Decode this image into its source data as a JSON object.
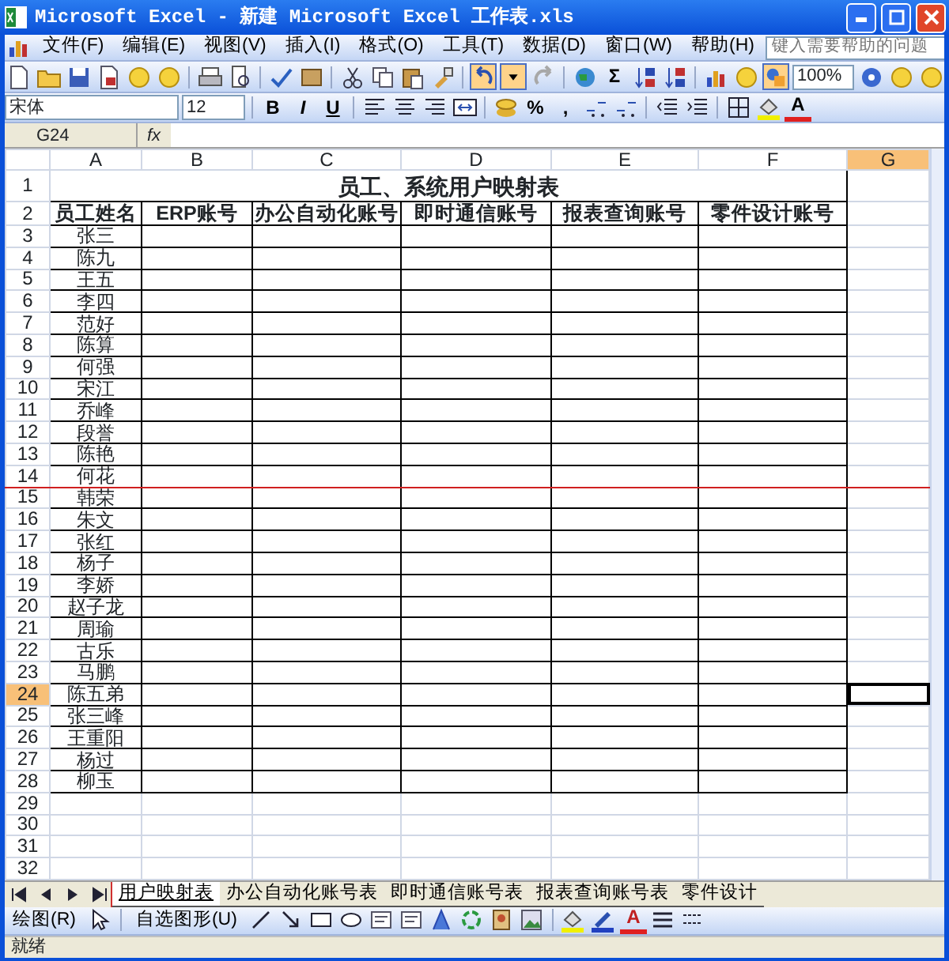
{
  "window": {
    "title": "Microsoft Excel - 新建 Microsoft Excel 工作表.xls"
  },
  "menu": {
    "items": [
      "文件(F)",
      "编辑(E)",
      "视图(V)",
      "插入(I)",
      "格式(O)",
      "工具(T)",
      "数据(D)",
      "窗口(W)",
      "帮助(H)"
    ],
    "help_box": {
      "placeholder": "键入需要帮助的问题"
    }
  },
  "standard_toolbar": {
    "sum": "Σ",
    "zoom": "100%"
  },
  "format_toolbar": {
    "font": "宋体",
    "size": "12",
    "bold": "B",
    "italic": "I",
    "underline": "U",
    "percent": "%",
    "comma": ",",
    "font_color": "A"
  },
  "formula_bar": {
    "name_box": "G24",
    "fx": "fx"
  },
  "sheet": {
    "columns": [
      {
        "label": "A",
        "selected": false
      },
      {
        "label": "B",
        "selected": false
      },
      {
        "label": "C",
        "selected": false
      },
      {
        "label": "D",
        "selected": false
      },
      {
        "label": "E",
        "selected": false
      },
      {
        "label": "F",
        "selected": false
      },
      {
        "label": "G",
        "selected": true
      }
    ],
    "rows": [
      {
        "number": "1",
        "selected": false,
        "kind": "title",
        "text": "员工、系统用户映射表"
      },
      {
        "number": "2",
        "selected": false,
        "kind": "header",
        "cells": [
          "员工姓名",
          "ERP账号",
          "办公自动化账号",
          "即时通信账号",
          "报表查询账号",
          "零件设计账号"
        ]
      },
      {
        "number": "3",
        "selected": false,
        "kind": "data",
        "name": "张三"
      },
      {
        "number": "4",
        "selected": false,
        "kind": "data",
        "name": "陈九"
      },
      {
        "number": "5",
        "selected": false,
        "kind": "data",
        "name": "王五"
      },
      {
        "number": "6",
        "selected": false,
        "kind": "data",
        "name": "李四"
      },
      {
        "number": "7",
        "selected": false,
        "kind": "data",
        "name": "范好"
      },
      {
        "number": "8",
        "selected": false,
        "kind": "data",
        "name": "陈算"
      },
      {
        "number": "9",
        "selected": false,
        "kind": "data",
        "name": "何强"
      },
      {
        "number": "10",
        "selected": false,
        "kind": "data",
        "name": "宋江"
      },
      {
        "number": "11",
        "selected": false,
        "kind": "data",
        "name": "乔峰"
      },
      {
        "number": "12",
        "selected": false,
        "kind": "data",
        "name": "段誉"
      },
      {
        "number": "13",
        "selected": false,
        "kind": "data",
        "name": "陈艳"
      },
      {
        "number": "14",
        "selected": false,
        "kind": "data",
        "name": "何花",
        "marked": true
      },
      {
        "number": "15",
        "selected": false,
        "kind": "data",
        "name": "韩荣"
      },
      {
        "number": "16",
        "selected": false,
        "kind": "data",
        "name": "朱文"
      },
      {
        "number": "17",
        "selected": false,
        "kind": "data",
        "name": "张红"
      },
      {
        "number": "18",
        "selected": false,
        "kind": "data",
        "name": "杨子"
      },
      {
        "number": "19",
        "selected": false,
        "kind": "data",
        "name": "李娇"
      },
      {
        "number": "20",
        "selected": false,
        "kind": "data",
        "name": "赵子龙"
      },
      {
        "number": "21",
        "selected": false,
        "kind": "data",
        "name": "周瑜"
      },
      {
        "number": "22",
        "selected": false,
        "kind": "data",
        "name": "古乐"
      },
      {
        "number": "23",
        "selected": false,
        "kind": "data",
        "name": "马鹏"
      },
      {
        "number": "24",
        "selected": true,
        "kind": "data",
        "name": "陈五弟"
      },
      {
        "number": "25",
        "selected": false,
        "kind": "data",
        "name": "张三峰"
      },
      {
        "number": "26",
        "selected": false,
        "kind": "data",
        "name": "王重阳"
      },
      {
        "number": "27",
        "selected": false,
        "kind": "data",
        "name": "杨过"
      },
      {
        "number": "28",
        "selected": false,
        "kind": "data",
        "name": "柳玉"
      },
      {
        "number": "29",
        "selected": false,
        "kind": "empty"
      },
      {
        "number": "30",
        "selected": false,
        "kind": "empty"
      },
      {
        "number": "31",
        "selected": false,
        "kind": "empty"
      },
      {
        "number": "32",
        "selected": false,
        "kind": "empty"
      }
    ]
  },
  "sheet_tabs": [
    {
      "label": "用户映射表",
      "selected": true
    },
    {
      "label": "办公自动化账号表",
      "selected": false
    },
    {
      "label": "即时通信账号表",
      "selected": false
    },
    {
      "label": "报表查询账号表",
      "selected": false
    },
    {
      "label": "零件设计",
      "selected": false
    }
  ],
  "drawing_toolbar": {
    "draw": "绘图(R)",
    "autoshapes": "自选图形(U)",
    "font_color": "A"
  },
  "status_bar": {
    "text": "就绪"
  }
}
